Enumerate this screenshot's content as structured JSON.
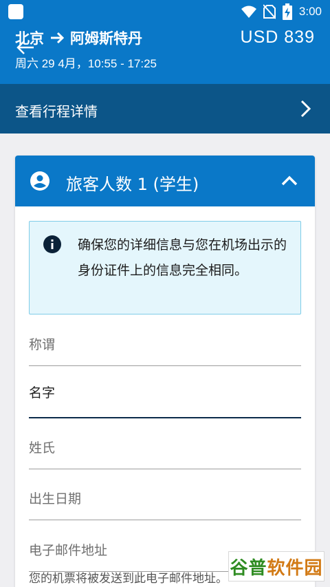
{
  "status_bar": {
    "time": "3:00",
    "icons": [
      "wifi-icon",
      "no-sim-icon",
      "battery-charging-icon"
    ]
  },
  "header": {
    "origin": "北京",
    "destination": "阿姆斯特丹",
    "date_time": "周六 29 4月，10:55 - 17:25",
    "price": "USD 839"
  },
  "itinerary": {
    "label": "查看行程详情"
  },
  "passenger_card": {
    "title": "旅客人数 1 (学生)",
    "info_message": "确保您的详细信息与您在机场出示的身份证件上的信息完全相同。",
    "fields": [
      {
        "label": "称谓"
      },
      {
        "label": "名字"
      },
      {
        "label": "姓氏"
      },
      {
        "label": "出生日期"
      },
      {
        "label": "电子邮件地址"
      }
    ],
    "email_helper": "您的机票将被发送到此电子邮件地址。"
  },
  "watermark": {
    "part1": "谷普",
    "part2": "软件园"
  },
  "colors": {
    "primary": "#0a78c8",
    "itinerary_bar": "#0c5588",
    "info_bg": "#e4f6fc",
    "info_border": "#7fcce8",
    "focus_line": "#0b2a4a"
  }
}
